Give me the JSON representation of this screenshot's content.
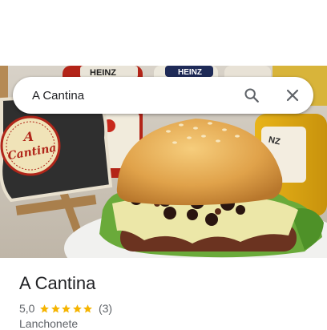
{
  "search": {
    "query": "A Cantina"
  },
  "place": {
    "name": "A Cantina",
    "rating": "5,0",
    "rating_value": 5,
    "review_count": "(3)",
    "category": "Lanchonete"
  },
  "photo": {
    "sign_line1": "A",
    "sign_line2": "Cantina",
    "bottle_brand": "HEINZ"
  },
  "colors": {
    "star": "#f5b400",
    "secondary_text": "#5f6368",
    "primary_text": "#202124"
  }
}
